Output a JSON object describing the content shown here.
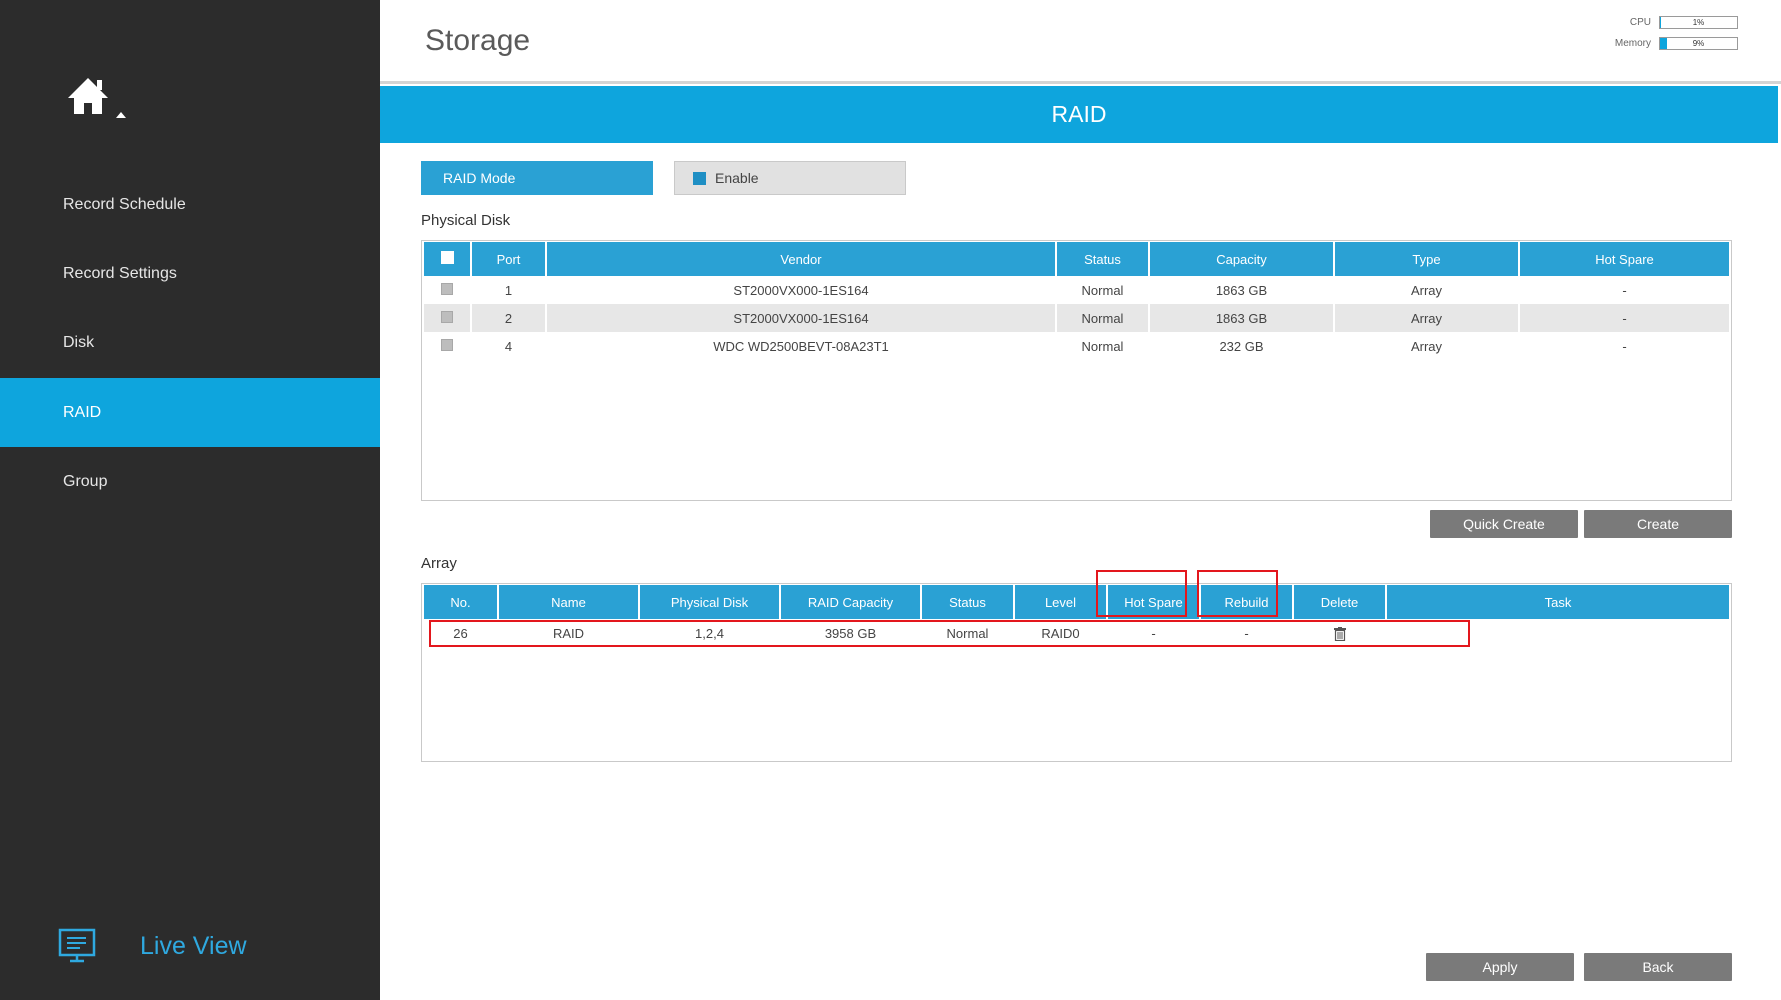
{
  "sidebar": {
    "items": [
      {
        "label": "Record Schedule"
      },
      {
        "label": "Record Settings"
      },
      {
        "label": "Disk"
      },
      {
        "label": "RAID"
      },
      {
        "label": "Group"
      }
    ],
    "live_view_label": "Live View",
    "active_item": "RAID"
  },
  "header": {
    "title": "Storage",
    "cpu": {
      "label": "CPU",
      "value_text": "1%",
      "percent": 1
    },
    "memory": {
      "label": "Memory",
      "value_text": "9%",
      "percent": 9
    }
  },
  "banner": {
    "title": "RAID"
  },
  "raid_mode": {
    "label": "RAID Mode",
    "enable_label": "Enable",
    "enabled": true
  },
  "physical_disk": {
    "title": "Physical Disk",
    "columns": [
      "Port",
      "Vendor",
      "Status",
      "Capacity",
      "Type",
      "Hot Spare"
    ],
    "rows": [
      {
        "port": "1",
        "vendor": "ST2000VX000-1ES164",
        "status": "Normal",
        "capacity": "1863 GB",
        "type": "Array",
        "hot_spare": "-"
      },
      {
        "port": "2",
        "vendor": "ST2000VX000-1ES164",
        "status": "Normal",
        "capacity": "1863 GB",
        "type": "Array",
        "hot_spare": "-"
      },
      {
        "port": "4",
        "vendor": "WDC WD2500BEVT-08A23T1",
        "status": "Normal",
        "capacity": "232 GB",
        "type": "Array",
        "hot_spare": "-"
      }
    ]
  },
  "buttons": {
    "quick_create": "Quick Create",
    "create": "Create",
    "apply": "Apply",
    "back": "Back"
  },
  "array": {
    "title": "Array",
    "columns": [
      "No.",
      "Name",
      "Physical Disk",
      "RAID Capacity",
      "Status",
      "Level",
      "Hot Spare",
      "Rebuild",
      "Delete",
      "Task"
    ],
    "rows": [
      {
        "no": "26",
        "name": "RAID",
        "physical_disk": "1,2,4",
        "raid_capacity": "3958 GB",
        "status": "Normal",
        "level": "RAID0",
        "hot_spare": "-",
        "rebuild": "-",
        "task": ""
      }
    ]
  },
  "colors": {
    "accent": "#0ea5dd",
    "header_blue": "#2aa1d4",
    "sidebar": "#2c2c2c",
    "annotation": "#e3171d"
  }
}
